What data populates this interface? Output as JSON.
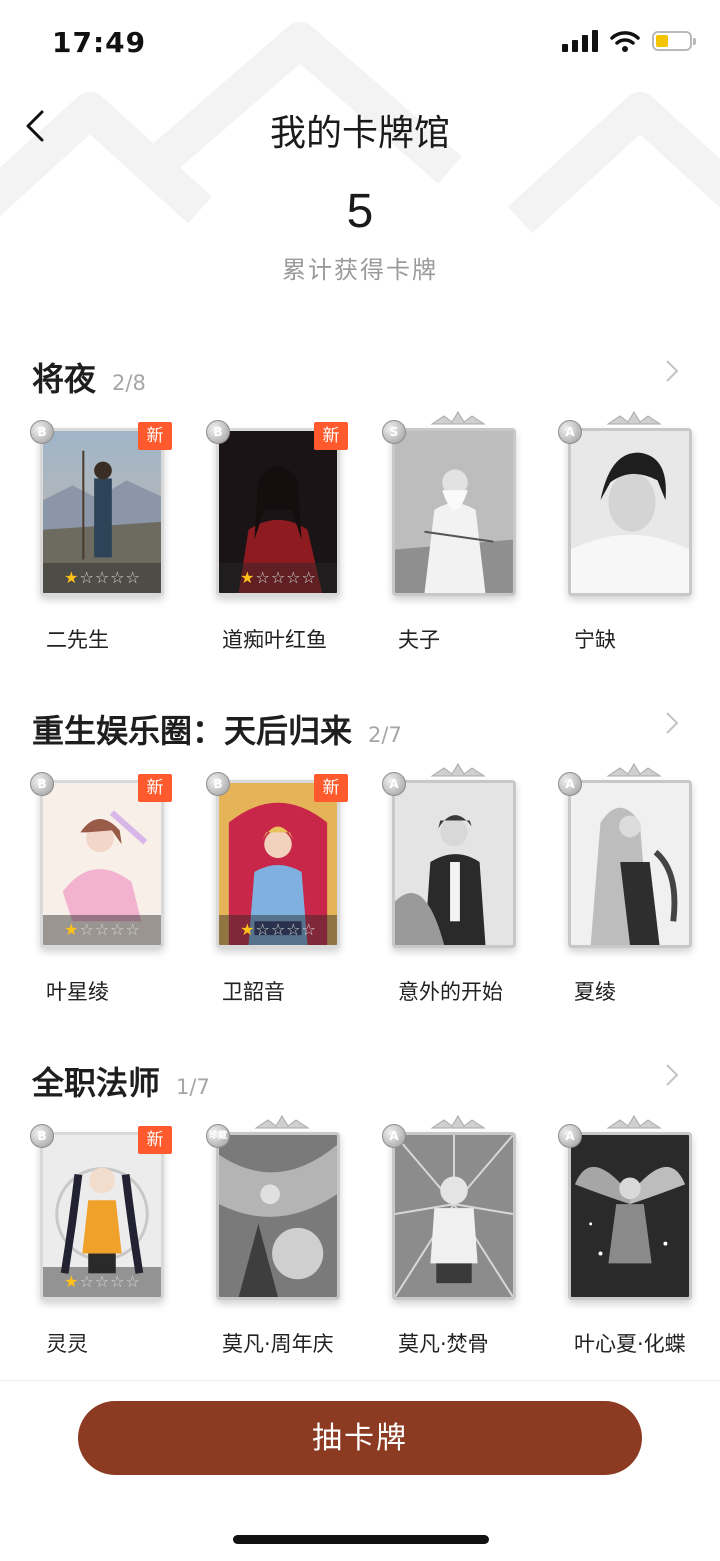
{
  "status_bar": {
    "time": "17:49"
  },
  "header": {
    "title": "我的卡牌馆"
  },
  "summary": {
    "count": "5",
    "label": "累计获得卡牌"
  },
  "sections": [
    {
      "name": "将夜",
      "progress": "2/8",
      "cards": [
        {
          "name": "二先生",
          "grade": "B",
          "new_label": "新",
          "stars": 1,
          "owned": true
        },
        {
          "name": "道痴叶红鱼",
          "grade": "B",
          "new_label": "新",
          "stars": 1,
          "owned": true
        },
        {
          "name": "夫子",
          "grade": "S",
          "owned": false
        },
        {
          "name": "宁缺",
          "grade": "A",
          "owned": false
        }
      ]
    },
    {
      "name": "重生娱乐圈：天后归来",
      "progress": "2/7",
      "cards": [
        {
          "name": "叶星绫",
          "grade": "B",
          "new_label": "新",
          "stars": 1,
          "owned": true
        },
        {
          "name": "卫韶音",
          "grade": "B",
          "new_label": "新",
          "stars": 1,
          "owned": true
        },
        {
          "name": "意外的开始",
          "grade": "A",
          "owned": false
        },
        {
          "name": "夏绫",
          "grade": "A",
          "owned": false
        }
      ]
    },
    {
      "name": "全职法师",
      "progress": "1/7",
      "cards": [
        {
          "name": "灵灵",
          "grade": "B",
          "new_label": "新",
          "stars": 1,
          "owned": true
        },
        {
          "name": "莫凡·周年庆",
          "grade": "珍藏",
          "owned": false
        },
        {
          "name": "莫凡·焚骨",
          "grade": "A",
          "owned": false
        },
        {
          "name": "叶心夏·化蝶",
          "grade": "A",
          "owned": false
        }
      ]
    }
  ],
  "footer": {
    "draw_label": "抽卡牌"
  },
  "colors": {
    "accent": "#8c3b22",
    "new_badge": "#ff5a2e",
    "star_on": "#ffc21a"
  }
}
